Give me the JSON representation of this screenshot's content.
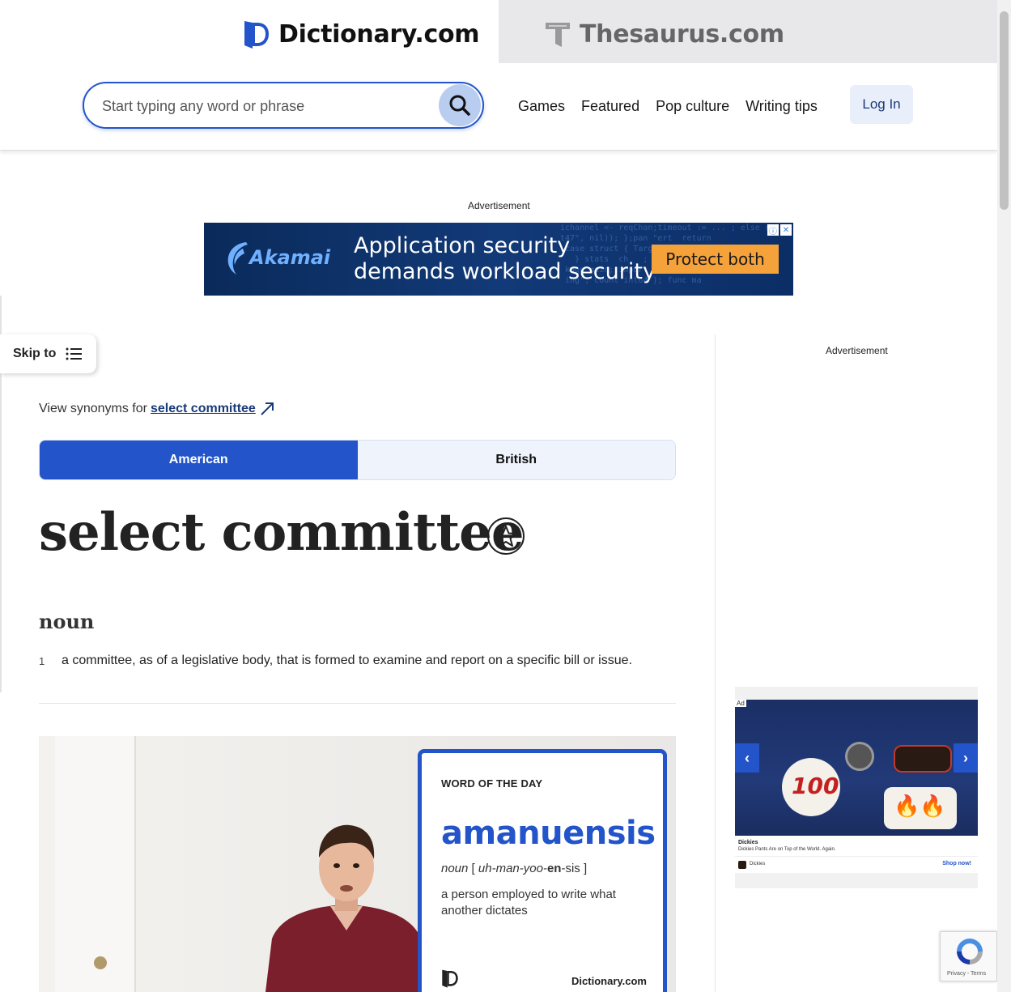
{
  "brands": {
    "dictionary": "Dictionary.com",
    "thesaurus": "Thesaurus.com"
  },
  "search": {
    "placeholder": "Start typing any word or phrase"
  },
  "nav": {
    "games": "Games",
    "featured": "Featured",
    "pop_culture": "Pop culture",
    "writing_tips": "Writing tips",
    "login": "Log In"
  },
  "ads": {
    "label": "Advertisement",
    "banner": {
      "brand": "Akamai",
      "headline_line1": "Application security",
      "headline_line2": "demands workload security",
      "cta": "Protect both"
    },
    "sidebar": {
      "label": "Advertisement",
      "tag": "Ad",
      "brand": "Dickies",
      "description": "Dickies Pants Are on Top of the World. Again.",
      "small_brand": "Dickies",
      "cta": "Shop now!"
    }
  },
  "skip_to": "Skip to",
  "entry": {
    "synonyms_prefix": "View synonyms for",
    "synonyms_link": "select committee",
    "dialect_american": "American",
    "dialect_british": "British",
    "headword": "select committee",
    "part_of_speech": "noun",
    "definitions": [
      {
        "number": "1",
        "text": "a committee, as of a legislative body, that is formed to examine and report on a specific bill or issue."
      }
    ]
  },
  "video": {
    "wotd_label": "WORD OF THE DAY",
    "word": "amanuensis",
    "pos": "noun",
    "pron_open": "[ ",
    "pron_pre": "uh-man-yoo-",
    "pron_stress": "en",
    "pron_post": "-sis ]",
    "meaning": "a person employed to write what another dictates",
    "brand": "Dictionary.com"
  },
  "recaptcha": {
    "terms": "Privacy - Terms"
  },
  "colors": {
    "accent": "#2354c9",
    "ad_cta": "#f5a23a"
  }
}
